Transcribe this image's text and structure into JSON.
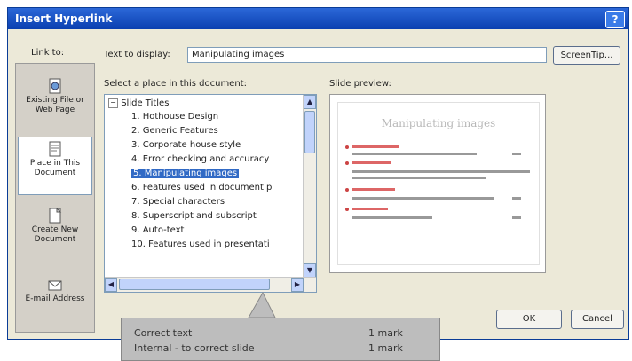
{
  "dialog": {
    "title": "Insert Hyperlink",
    "help_label": "?"
  },
  "link_to": {
    "label": "Link to:",
    "items": [
      {
        "label": "Existing File or Web Page",
        "icon": "globe-file-icon"
      },
      {
        "label": "Place in This Document",
        "icon": "document-place-icon"
      },
      {
        "label": "Create New Document",
        "icon": "new-document-icon"
      },
      {
        "label": "E-mail Address",
        "icon": "email-icon"
      }
    ]
  },
  "text_to_display": {
    "label": "Text to display:",
    "value": "Manipulating images"
  },
  "screentip_button": "ScreenTip...",
  "place_list": {
    "label": "Select a place in this document:",
    "root": "Slide Titles",
    "items": [
      "1. Hothouse Design",
      "2. Generic Features",
      "3. Corporate house style",
      "4. Error checking and accuracy",
      "5. Manipulating images",
      "6. Features used in document p",
      "7. Special characters",
      "8. Superscript and subscript",
      "9. Auto-text",
      "10. Features used in presentati"
    ],
    "selected_index": 4
  },
  "slide_preview": {
    "label": "Slide preview:",
    "slide_title": "Manipulating images"
  },
  "buttons": {
    "ok": "OK",
    "cancel": "Cancel"
  },
  "callout": {
    "rows": [
      {
        "label": "Correct text",
        "score": "1 mark"
      },
      {
        "label": "Internal - to correct slide",
        "score": "1 mark"
      }
    ]
  },
  "colors": {
    "titlebar": "#0a3fb0",
    "selection": "#316ac5",
    "dialog_bg": "#ece9d8"
  }
}
